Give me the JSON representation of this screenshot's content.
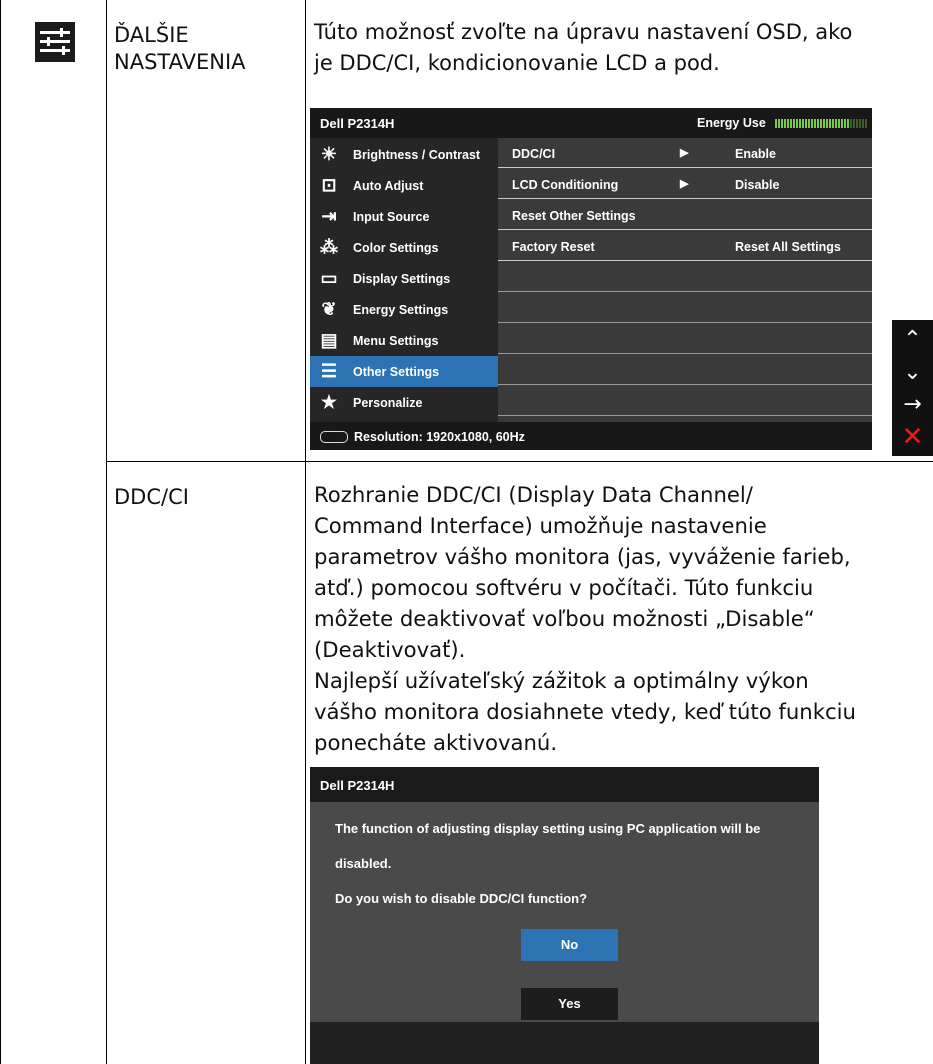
{
  "rows": [
    {
      "label_lines": [
        "ĎALŠIE",
        "NASTAVENIA"
      ],
      "description_lines": [
        "Túto možnosť zvoľte na úpravu nastavení OSD, ako",
        "je DDC/CI, kondicionovanie LCD a pod."
      ]
    },
    {
      "label": "DDC/CI",
      "description_lines": [
        "Rozhranie DDC/CI (Display Data Channel/",
        "Command Interface) umožňuje nastavenie",
        "parametrov vášho monitora (jas, vyváženie farieb,",
        "atď.) pomocou softvéru v počítači. Túto funkciu",
        "môžete deaktivovať voľbou možnosti „Disable“",
        "(Deaktivovať).",
        "Najlepší užívateľský zážitok a optimálny výkon",
        "vášho monitora dosiahnete vtedy, keď túto funkciu",
        "ponecháte aktivovanú."
      ]
    }
  ],
  "osd": {
    "title": "Dell P2314H",
    "energy_label": "Energy Use",
    "energy_level": 0.82,
    "menu": [
      {
        "label": "Brightness / Contrast",
        "icon": "brightness-icon",
        "glyph": "☀"
      },
      {
        "label": "Auto Adjust",
        "icon": "auto-adjust-icon",
        "glyph": "⊡"
      },
      {
        "label": "Input Source",
        "icon": "input-source-icon",
        "glyph": "⇥"
      },
      {
        "label": "Color Settings",
        "icon": "color-settings-icon",
        "glyph": "⁂"
      },
      {
        "label": "Display Settings",
        "icon": "display-settings-icon",
        "glyph": "▭"
      },
      {
        "label": "Energy Settings",
        "icon": "energy-settings-icon",
        "glyph": "❦"
      },
      {
        "label": "Menu Settings",
        "icon": "menu-settings-icon",
        "glyph": "▤"
      },
      {
        "label": "Other Settings",
        "icon": "other-settings-icon",
        "glyph": "☰",
        "active": true
      },
      {
        "label": "Personalize",
        "icon": "star-icon",
        "glyph": "★"
      }
    ],
    "submenu": [
      {
        "label": "DDC/CI",
        "arrow": "▶",
        "value": "Enable"
      },
      {
        "label": "LCD Conditioning",
        "arrow": "▶",
        "value": "Disable"
      },
      {
        "label": "Reset Other Settings",
        "arrow": "",
        "value": ""
      },
      {
        "label": "Factory Reset",
        "arrow": "",
        "value": "Reset All Settings"
      }
    ],
    "resolution": "Resolution: 1920x1080, 60Hz",
    "accent_color": "#2c73b4"
  },
  "side_nav": [
    {
      "name": "up-arrow-icon",
      "glyph": "⌃"
    },
    {
      "name": "down-arrow-icon",
      "glyph": "⌄"
    },
    {
      "name": "right-arrow-icon",
      "glyph": "→"
    },
    {
      "name": "close-icon",
      "glyph": "✕"
    }
  ],
  "dialog": {
    "title": "Dell P2314H",
    "message_line1": "The function of adjusting display setting using PC application will be",
    "message_line2": "disabled.",
    "question": "Do you wish to disable DDC/CI function?",
    "no_label": "No",
    "yes_label": "Yes"
  }
}
